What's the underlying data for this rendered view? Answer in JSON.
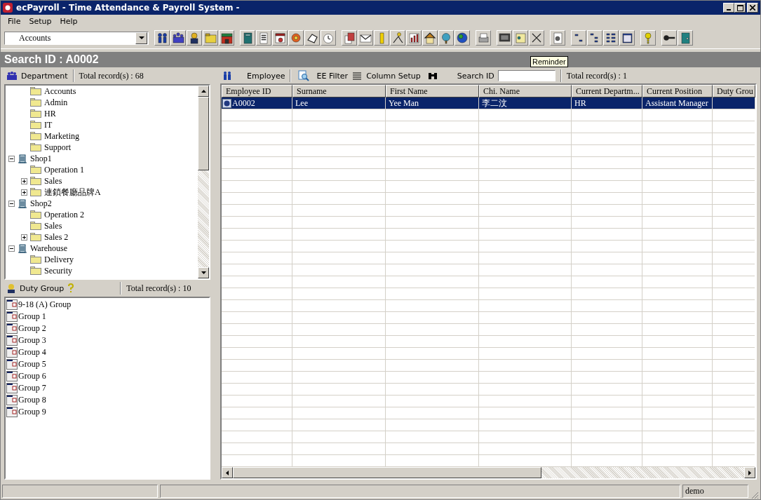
{
  "window": {
    "title": "ecPayroll - Time Attendance & Payroll System -"
  },
  "menu": [
    "File",
    "Setup",
    "Help"
  ],
  "toolbar": {
    "department_select": {
      "value": "Accounts"
    }
  },
  "tooltip": "Reminder",
  "search_header": "Search ID : A0002",
  "department_panel": {
    "title": "Department",
    "total": "Total record(s) : 68"
  },
  "tree": {
    "scrolled_children": [
      {
        "kind": "folder",
        "label": "Accounts"
      },
      {
        "kind": "folder",
        "label": "Admin"
      },
      {
        "kind": "folder",
        "label": "HR"
      },
      {
        "kind": "folder",
        "label": "IT"
      },
      {
        "kind": "folder",
        "label": "Marketing"
      },
      {
        "kind": "folder",
        "label": "Support"
      }
    ],
    "items": [
      {
        "kind": "building",
        "label": "Shop1",
        "expanded": true,
        "children": [
          {
            "kind": "folder",
            "label": "Operation 1"
          },
          {
            "kind": "folder",
            "label": "Sales",
            "expanded": false
          },
          {
            "kind": "folder",
            "label": "連鎖餐廳品牌A",
            "expanded": false
          }
        ]
      },
      {
        "kind": "building",
        "label": "Shop2",
        "expanded": true,
        "children": [
          {
            "kind": "folder",
            "label": "Operation 2"
          },
          {
            "kind": "folder",
            "label": "Sales"
          },
          {
            "kind": "folder",
            "label": "Sales 2",
            "expanded": false
          }
        ]
      },
      {
        "kind": "building",
        "label": "Warehouse",
        "expanded": true,
        "children": [
          {
            "kind": "folder",
            "label": "Delivery"
          },
          {
            "kind": "folder",
            "label": "Security"
          }
        ]
      }
    ]
  },
  "duty_panel": {
    "title": "Duty Group",
    "total": "Total record(s) : 10"
  },
  "duty_groups": [
    "9-18 (A) Group",
    "Group 1",
    "Group 2",
    "Group 3",
    "Group 4",
    "Group 5",
    "Group 6",
    "Group 7",
    "Group 8",
    "Group 9"
  ],
  "employee_toolbar": {
    "title": "Employee",
    "filter": "EE Filter",
    "column_setup": "Column Setup",
    "search_label": "Search ID",
    "total": "Total record(s) : 1"
  },
  "table": {
    "columns": [
      "Employee ID",
      "Surname",
      "First Name",
      "Chi. Name",
      "Current Departm...",
      "Current Position",
      "Duty Grou"
    ],
    "rows": [
      {
        "selected": true,
        "cells": [
          "A0002",
          "Lee",
          "Yee Man",
          "李二汶",
          "HR",
          "Assistant Manager",
          ""
        ]
      }
    ]
  },
  "status_bar": {
    "user": "demo"
  }
}
